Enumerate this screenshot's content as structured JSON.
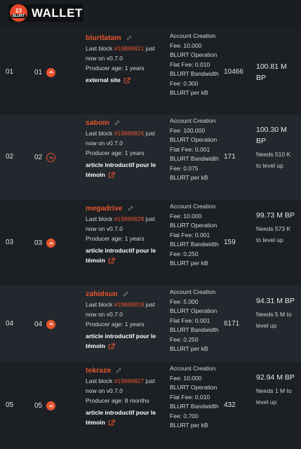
{
  "header": {
    "logo_top": "23",
    "logo_bottom": "BLURT",
    "title": "WALLET"
  },
  "colors": {
    "accent": "#e8542d",
    "background": "#1e2227",
    "row_alt": "#22282e"
  },
  "witnesses": [
    {
      "rank": "01",
      "rank2": "01",
      "voted": true,
      "name": "blurtlatam",
      "block_prefix": "Last block ",
      "block": "#19889821",
      "block_suffix": " just now on v0.7.0",
      "age": "Producer age: 1 years",
      "link": "external site",
      "fees": "Account Creation Fee: 10.000 BLURT Operation Flat Fee: 0.010 BLURT Bandwidth Fee: 0.300 BLURT per kB",
      "votes": "10466",
      "bp": "100.81 M BP",
      "needs": ""
    },
    {
      "rank": "02",
      "rank2": "02",
      "voted": false,
      "name": "saboin",
      "block_prefix": "Last block ",
      "block": "#19889826",
      "block_suffix": " just now on v0.7.0",
      "age": "Producer age: 1 years",
      "link": "article introductif pour le témoin",
      "fees": "Account Creation Fee: 100.000 BLURT Operation Flat Fee: 0.001 BLURT Bandwidth Fee: 0.075 BLURT per kB",
      "votes": "171",
      "bp": "100.30 M BP",
      "needs": "Needs 510 K to level up"
    },
    {
      "rank": "03",
      "rank2": "03",
      "voted": true,
      "name": "megadrive",
      "block_prefix": "Last block ",
      "block": "#19889828",
      "block_suffix": " just now on v0.7.0",
      "age": "Producer age: 1 years",
      "link": "article introductif pour le témoin",
      "fees": "Account Creation Fee: 10.000 BLURT Operation Flat Fee: 0.001 BLURT Bandwidth Fee: 0.250 BLURT per kB",
      "votes": "159",
      "bp": "99.73 M BP",
      "needs": "Needs 573 K to level up"
    },
    {
      "rank": "04",
      "rank2": "04",
      "voted": true,
      "name": "zahidsun",
      "block_prefix": "Last block ",
      "block": "#19889818",
      "block_suffix": " just now on v0.7.0",
      "age": "Producer age: 1 years",
      "link": "article introductif pour le témoin",
      "fees": "Account Creation Fee: 5.000 BLURT Operation Flat Fee: 0.001 BLURT Bandwidth Fee: 0.250 BLURT per kB",
      "votes": "6171",
      "bp": "94.31 M BP",
      "needs": "Needs 5 M to level up"
    },
    {
      "rank": "05",
      "rank2": "05",
      "voted": true,
      "name": "tekraze",
      "block_prefix": "Last block ",
      "block": "#19889827",
      "block_suffix": " just now on v0.7.0",
      "age": "Producer age: 8 months",
      "link": "article introductif pour le témoin",
      "fees": "Account Creation Fee: 10.000 BLURT Operation Flat Fee: 0.010 BLURT Bandwidth Fee: 0.700 BLURT per kB",
      "votes": "432",
      "bp": "92.94 M BP",
      "needs": "Needs 1 M to level up"
    }
  ]
}
